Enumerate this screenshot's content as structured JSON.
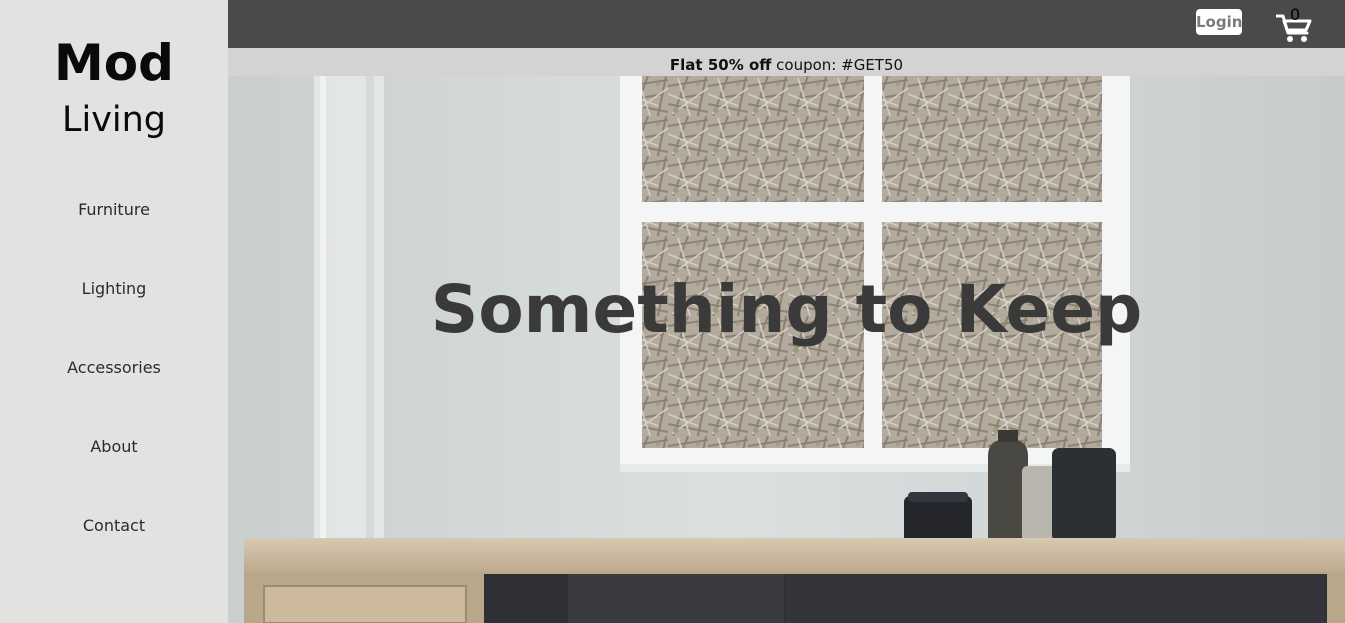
{
  "sidebar": {
    "brand_line1": "Mod",
    "brand_line2": "Living",
    "nav": [
      {
        "label": "Furniture"
      },
      {
        "label": "Lighting"
      },
      {
        "label": "Accessories"
      },
      {
        "label": "About"
      },
      {
        "label": "Contact"
      }
    ]
  },
  "header": {
    "login_label": "Login",
    "cart_icon": "shopping-cart-icon",
    "cart_count": "0"
  },
  "promo": {
    "bold_text": "Flat 50% off",
    "text": " coupon: #GET50"
  },
  "hero": {
    "title": "Something to Keep"
  },
  "colors": {
    "sidebar_bg": "#e2e2e0",
    "topbar_bg": "#4a4a4a",
    "promo_bg": "#d3d3d3",
    "hero_title": "#3a3a3a"
  }
}
